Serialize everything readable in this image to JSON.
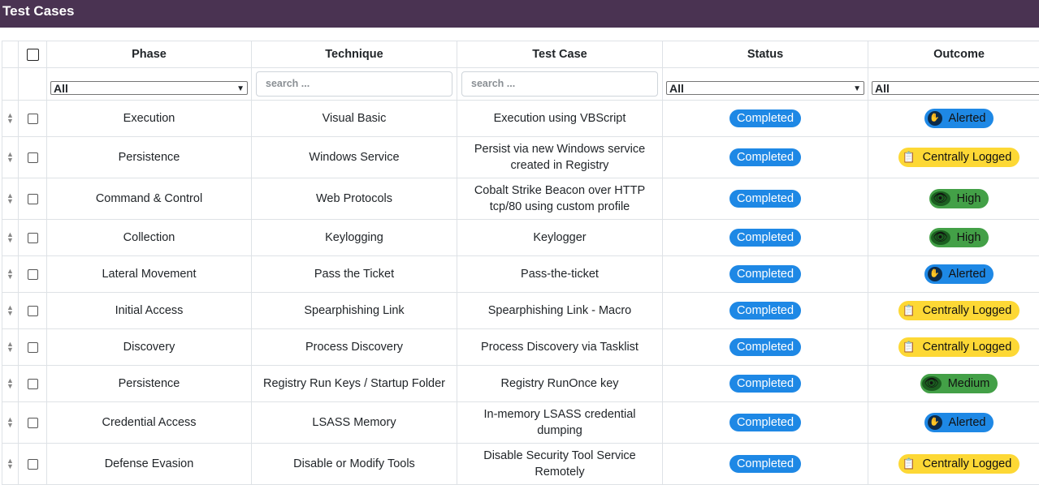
{
  "header": {
    "title": "Test Cases"
  },
  "columns": [
    "Phase",
    "Technique",
    "Test Case",
    "Status",
    "Outcome"
  ],
  "filters": {
    "phase": "All",
    "technique_placeholder": "search ...",
    "testcase_placeholder": "search ...",
    "status": "All",
    "outcome": "All"
  },
  "colors": {
    "header_bg": "#4a3352",
    "status_blue": "#1e88e5",
    "alerted": "#1e88e5",
    "centrally_logged": "#fdd835",
    "high": "#43a047",
    "medium": "#43a047"
  },
  "rows": [
    {
      "phase": "Execution",
      "technique": "Visual Basic",
      "test_case": "Execution using VBScript",
      "status": "Completed",
      "outcome": "Alerted",
      "outcome_type": "alerted",
      "outcome_icon": "hand-icon"
    },
    {
      "phase": "Persistence",
      "technique": "Windows Service",
      "test_case": "Persist via new Windows service created in Registry",
      "status": "Completed",
      "outcome": "Centrally Logged",
      "outcome_type": "logged",
      "outcome_icon": "clipboard-icon"
    },
    {
      "phase": "Command & Control",
      "technique": "Web Protocols",
      "test_case": "Cobalt Strike Beacon over HTTP tcp/80 using custom profile",
      "status": "Completed",
      "outcome": "High",
      "outcome_type": "high",
      "outcome_icon": "eye-icon"
    },
    {
      "phase": "Collection",
      "technique": "Keylogging",
      "test_case": "Keylogger",
      "status": "Completed",
      "outcome": "High",
      "outcome_type": "high",
      "outcome_icon": "eye-icon"
    },
    {
      "phase": "Lateral Movement",
      "technique": "Pass the Ticket",
      "test_case": "Pass-the-ticket",
      "status": "Completed",
      "outcome": "Alerted",
      "outcome_type": "alerted",
      "outcome_icon": "hand-icon"
    },
    {
      "phase": "Initial Access",
      "technique": "Spearphishing Link",
      "test_case": "Spearphishing Link - Macro",
      "status": "Completed",
      "outcome": "Centrally Logged",
      "outcome_type": "logged",
      "outcome_icon": "clipboard-icon"
    },
    {
      "phase": "Discovery",
      "technique": "Process Discovery",
      "test_case": "Process Discovery via Tasklist",
      "status": "Completed",
      "outcome": "Centrally Logged",
      "outcome_type": "logged",
      "outcome_icon": "clipboard-icon"
    },
    {
      "phase": "Persistence",
      "technique": "Registry Run Keys / Startup Folder",
      "test_case": "Registry RunOnce key",
      "status": "Completed",
      "outcome": "Medium",
      "outcome_type": "medium",
      "outcome_icon": "eye-icon"
    },
    {
      "phase": "Credential Access",
      "technique": "LSASS Memory",
      "test_case": "In-memory LSASS credential dumping",
      "status": "Completed",
      "outcome": "Alerted",
      "outcome_type": "alerted",
      "outcome_icon": "hand-icon"
    },
    {
      "phase": "Defense Evasion",
      "technique": "Disable or Modify Tools",
      "test_case": "Disable Security Tool Service Remotely",
      "status": "Completed",
      "outcome": "Centrally Logged",
      "outcome_type": "logged",
      "outcome_icon": "clipboard-icon"
    }
  ]
}
